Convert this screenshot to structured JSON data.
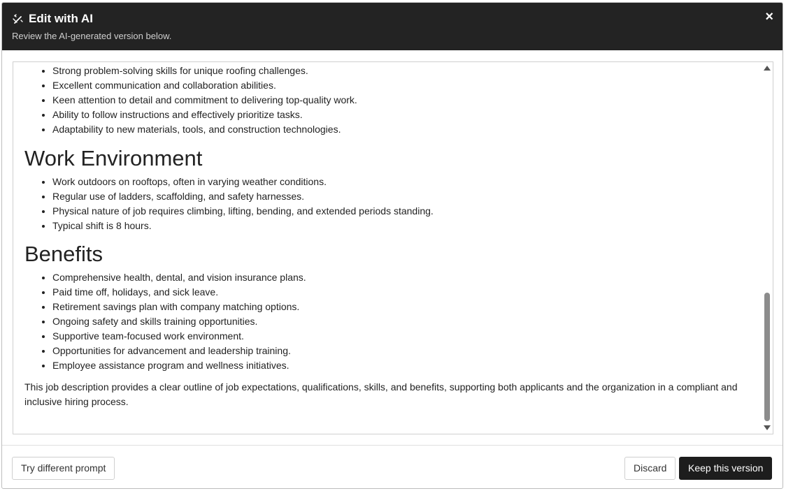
{
  "dialog": {
    "title": "Edit with AI",
    "subtitle": "Review the AI-generated version below.",
    "close_label": "×",
    "header_icon": "magic-wand-icon"
  },
  "content": {
    "skills_items": [
      "Strong problem-solving skills for unique roofing challenges.",
      "Excellent communication and collaboration abilities.",
      "Keen attention to detail and commitment to delivering top-quality work.",
      "Ability to follow instructions and effectively prioritize tasks.",
      "Adaptability to new materials, tools, and construction technologies."
    ],
    "work_env_heading": "Work Environment",
    "work_env_items": [
      "Work outdoors on rooftops, often in varying weather conditions.",
      "Regular use of ladders, scaffolding, and safety harnesses.",
      "Physical nature of job requires climbing, lifting, bending, and extended periods standing.",
      "Typical shift is 8 hours."
    ],
    "benefits_heading": "Benefits",
    "benefits_items": [
      "Comprehensive health, dental, and vision insurance plans.",
      "Paid time off, holidays, and sick leave.",
      "Retirement savings plan with company matching options.",
      "Ongoing safety and skills training opportunities.",
      "Supportive team-focused work environment.",
      "Opportunities for advancement and leadership training.",
      "Employee assistance program and wellness initiatives."
    ],
    "closing_paragraph": "This job description provides a clear outline of job expectations, qualifications, skills, and benefits, supporting both applicants and the organization in a compliant and inclusive hiring process."
  },
  "footer": {
    "try_different_label": "Try different prompt",
    "discard_label": "Discard",
    "keep_label": "Keep this version"
  }
}
